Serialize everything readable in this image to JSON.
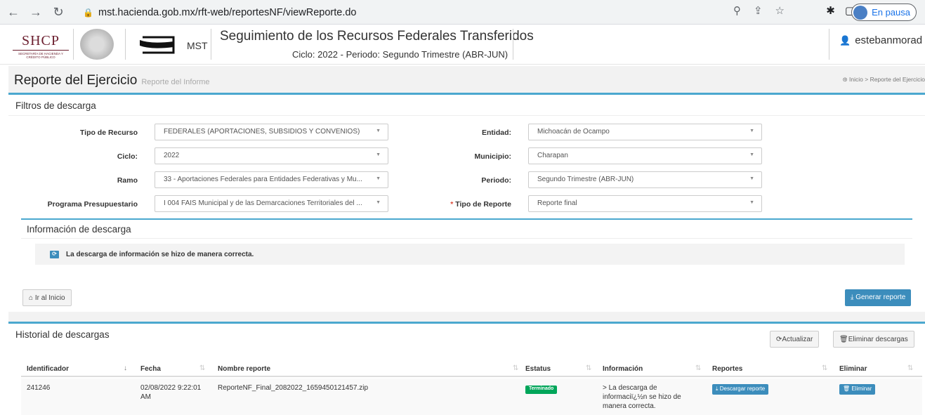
{
  "browser": {
    "url": "mst.hacienda.gob.mx/rft-web/reportesNF/viewReporte.do",
    "profile_status": "En pausa"
  },
  "header": {
    "logo_text": "SHCP",
    "logo_subtext": "SECRETARÍA DE HACIENDA Y CRÉDITO PÚBLICO",
    "mst_label": "MST",
    "title": "Seguimiento de los Recursos Federales Transferidos",
    "subtitle": "Ciclo: 2022 - Periodo: Segundo Trimestre (ABR-JUN)",
    "username": "estebanmorad"
  },
  "page": {
    "title": "Reporte del Ejercicio",
    "subtitle": "Reporte del Informe",
    "breadcrumb": [
      "Inicio",
      "Reporte del Ejercicio"
    ]
  },
  "filters": {
    "heading": "Filtros de descarga",
    "tipo_recurso": {
      "label": "Tipo de Recurso",
      "value": "FEDERALES (APORTACIONES, SUBSIDIOS Y CONVENIOS)"
    },
    "ciclo": {
      "label": "Ciclo:",
      "value": "2022"
    },
    "ramo": {
      "label": "Ramo",
      "value": "33 - Aportaciones Federales para Entidades Federativas y Mu..."
    },
    "programa": {
      "label": "Programa Presupuestario",
      "value": "I 004 FAIS Municipal y de las Demarcaciones Territoriales del ..."
    },
    "entidad": {
      "label": "Entidad:",
      "value": "Michoacán de Ocampo"
    },
    "municipio": {
      "label": "Municipio:",
      "value": "Charapan"
    },
    "periodo": {
      "label": "Periodo:",
      "value": "Segundo Trimestre (ABR-JUN)"
    },
    "tipo_reporte": {
      "required_mark": "*",
      "label": "Tipo de Reporte",
      "value": "Reporte final"
    }
  },
  "download_info": {
    "heading": "Información de descarga",
    "message": "La descarga de información se hizo de manera correcta."
  },
  "actions": {
    "home_button": "Ir al Inicio",
    "generate_button": "Generar reporte"
  },
  "history": {
    "heading": "Historial de descargas",
    "refresh_button": "Actualizar",
    "delete_all_button": "Eliminar descargas",
    "columns": [
      "Identificador",
      "Fecha",
      "Nombre reporte",
      "Estatus",
      "Información",
      "Reportes",
      "Eliminar"
    ],
    "rows": [
      {
        "id": "241246",
        "fecha": "02/08/2022 9:22:01 AM",
        "nombre": "ReporteNF_Final_2082022_1659450121457.zip",
        "estatus": "Terminado",
        "informacion": "> La descarga de informaciï¿½n se hizo de manera correcta.",
        "download_label": "Descargar reporte",
        "delete_label": "Eliminar"
      }
    ]
  },
  "colors": {
    "accent": "#3c8dbc",
    "box_border": "#4ba8cf",
    "success": "#00a65a",
    "brand": "#6b1e2e"
  }
}
